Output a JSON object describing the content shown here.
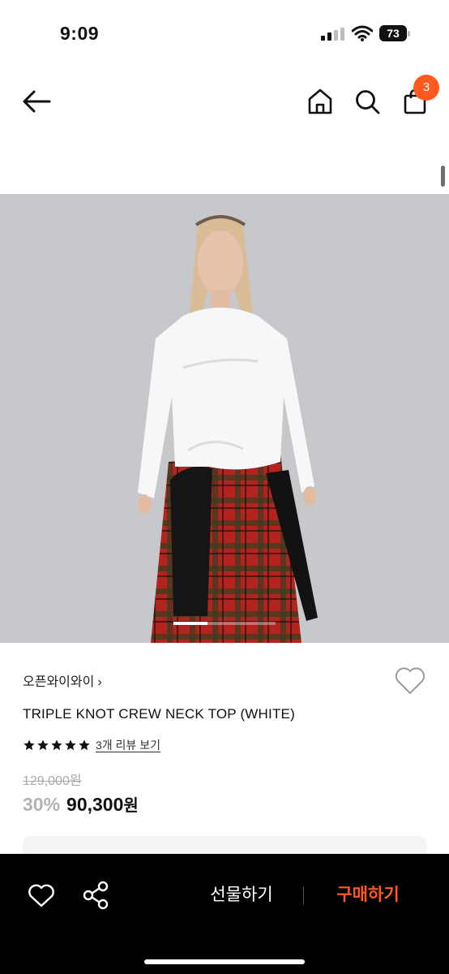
{
  "status_bar": {
    "time": "9:09",
    "battery": "73"
  },
  "header": {
    "cart_count": "3",
    "icons": [
      "back-arrow-icon",
      "home-icon",
      "search-icon",
      "cart-icon"
    ]
  },
  "product": {
    "brand": "오픈와이와이",
    "brand_chevron": "›",
    "title": "TRIPLE KNOT CREW NECK TOP (WHITE)",
    "rating": 5,
    "review_link": "3개 리뷰 보기",
    "original_price": "129,000원",
    "discount": "30%",
    "sale_price": "90,300",
    "sale_unit": "원",
    "image_position": 0.33
  },
  "bottom_bar": {
    "gift_label": "선물하기",
    "buy_label": "구매하기"
  },
  "colors": {
    "accent": "#ff5a1f",
    "background": "#ffffff",
    "bottom_bar": "#000000"
  }
}
